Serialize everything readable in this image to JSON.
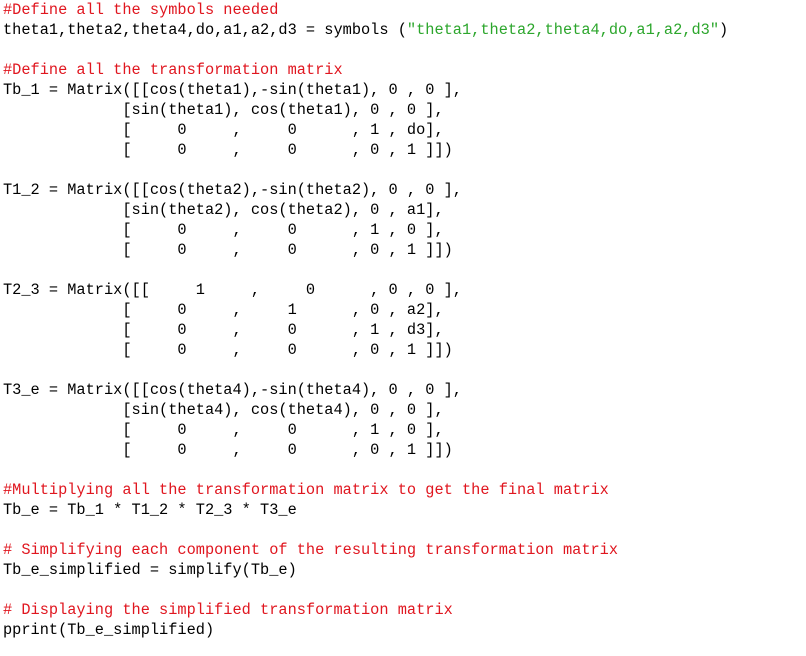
{
  "editor": {
    "colors": {
      "comment": "#e0161f",
      "string": "#2ca62c",
      "code": "#000000",
      "background": "#ffffff"
    },
    "lines": [
      [
        {
          "t": "comment",
          "v": "#Define all the symbols needed"
        }
      ],
      [
        {
          "t": "code",
          "v": "theta1,theta2,theta4,do,a1,a2,d3 = symbols ("
        },
        {
          "t": "string",
          "v": "\"theta1,theta2,theta4,do,a1,a2,d3\""
        },
        {
          "t": "code",
          "v": ")"
        }
      ],
      [],
      [
        {
          "t": "comment",
          "v": "#Define all the transformation matrix"
        }
      ],
      [
        {
          "t": "code",
          "v": "Tb_1 = Matrix([[cos(theta1),-sin(theta1), 0 , 0 ],"
        }
      ],
      [
        {
          "t": "code",
          "v": "             [sin(theta1), cos(theta1), 0 , 0 ],"
        }
      ],
      [
        {
          "t": "code",
          "v": "             [     0     ,     0      , 1 , do],"
        }
      ],
      [
        {
          "t": "code",
          "v": "             [     0     ,     0      , 0 , 1 ]])"
        }
      ],
      [],
      [
        {
          "t": "code",
          "v": "T1_2 = Matrix([[cos(theta2),-sin(theta2), 0 , 0 ],"
        }
      ],
      [
        {
          "t": "code",
          "v": "             [sin(theta2), cos(theta2), 0 , a1],"
        }
      ],
      [
        {
          "t": "code",
          "v": "             [     0     ,     0      , 1 , 0 ],"
        }
      ],
      [
        {
          "t": "code",
          "v": "             [     0     ,     0      , 0 , 1 ]])"
        }
      ],
      [],
      [
        {
          "t": "code",
          "v": "T2_3 = Matrix([[     1     ,     0      , 0 , 0 ],"
        }
      ],
      [
        {
          "t": "code",
          "v": "             [     0     ,     1      , 0 , a2],"
        }
      ],
      [
        {
          "t": "code",
          "v": "             [     0     ,     0      , 1 , d3],"
        }
      ],
      [
        {
          "t": "code",
          "v": "             [     0     ,     0      , 0 , 1 ]])"
        }
      ],
      [],
      [
        {
          "t": "code",
          "v": "T3_e = Matrix([[cos(theta4),-sin(theta4), 0 , 0 ],"
        }
      ],
      [
        {
          "t": "code",
          "v": "             [sin(theta4), cos(theta4), 0 , 0 ],"
        }
      ],
      [
        {
          "t": "code",
          "v": "             [     0     ,     0      , 1 , 0 ],"
        }
      ],
      [
        {
          "t": "code",
          "v": "             [     0     ,     0      , 0 , 1 ]])"
        }
      ],
      [],
      [
        {
          "t": "comment",
          "v": "#Multiplying all the transformation matrix to get the final matrix"
        }
      ],
      [
        {
          "t": "code",
          "v": "Tb_e = Tb_1 * T1_2 * T2_3 * T3_e"
        }
      ],
      [],
      [
        {
          "t": "comment",
          "v": "# Simplifying each component of the resulting transformation matrix"
        }
      ],
      [
        {
          "t": "code",
          "v": "Tb_e_simplified = simplify(Tb_e)"
        }
      ],
      [],
      [
        {
          "t": "comment",
          "v": "# Displaying the simplified transformation matrix"
        }
      ],
      [
        {
          "t": "code",
          "v": "pprint(Tb_e_simplified)"
        }
      ]
    ]
  }
}
